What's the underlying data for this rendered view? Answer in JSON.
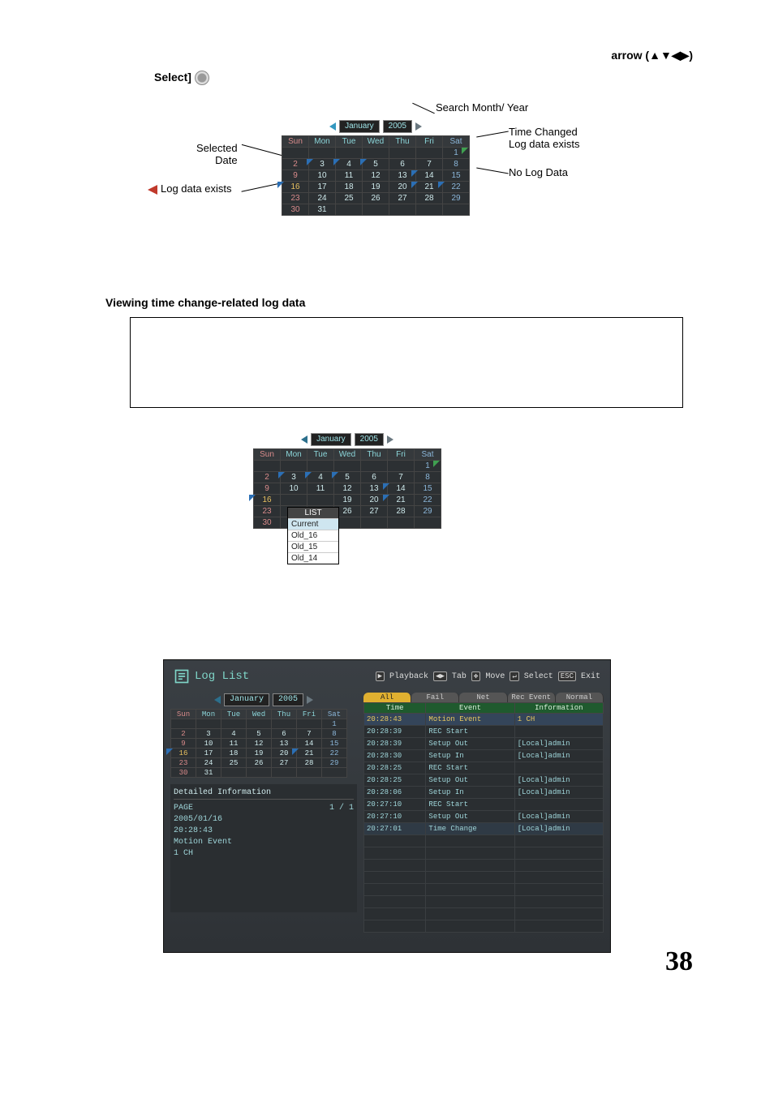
{
  "header": {
    "arrow_label": "arrow (▲▼◀▶)",
    "select_label": "Select]"
  },
  "diagram1": {
    "labels": {
      "search_month_year": "Search Month/ Year",
      "selected_date": "Selected\nDate",
      "log_data_exists": "Log data exists",
      "time_changed": "Time Changed\nLog data exists",
      "no_log_data": "No Log Data"
    }
  },
  "calendar": {
    "month": "January",
    "year": "2005",
    "days": [
      "Sun",
      "Mon",
      "Tue",
      "Wed",
      "Thu",
      "Fri",
      "Sat"
    ],
    "weeks": [
      [
        "",
        "",
        "",
        "",
        "",
        "",
        "1"
      ],
      [
        "2",
        "3",
        "4",
        "5",
        "6",
        "7",
        "8"
      ],
      [
        "9",
        "10",
        "11",
        "12",
        "13",
        "14",
        "15"
      ],
      [
        "16",
        "17",
        "18",
        "19",
        "20",
        "21",
        "22"
      ],
      [
        "23",
        "24",
        "25",
        "26",
        "27",
        "28",
        "29"
      ],
      [
        "30",
        "31",
        "",
        "",
        "",
        "",
        ""
      ]
    ]
  },
  "section2_title": "Viewing time change-related log data",
  "dropdown": {
    "header": "LIST",
    "items": [
      "Current",
      "Old_16",
      "Old_15",
      "Old_14"
    ]
  },
  "loglist": {
    "title": "Log List",
    "hints": [
      "Playback",
      "Tab",
      "Move",
      "Select",
      "Exit"
    ],
    "hint_keys": [
      "▶",
      "◀▶",
      "✥",
      "↵",
      "ESC"
    ],
    "filters": [
      "All",
      "Fail",
      "Net",
      "Rec Event",
      "Normal"
    ],
    "active_filter": 0,
    "table_headers": [
      "Time",
      "Event",
      "Information"
    ],
    "rows": [
      {
        "time": "20:28:43",
        "event": "Motion Event",
        "info": "1 CH",
        "sel": true
      },
      {
        "time": "20:28:39",
        "event": "REC Start",
        "info": ""
      },
      {
        "time": "20:28:39",
        "event": "Setup Out",
        "info": "[Local]admin"
      },
      {
        "time": "20:28:30",
        "event": "Setup In",
        "info": "[Local]admin"
      },
      {
        "time": "20:28:25",
        "event": "REC Start",
        "info": ""
      },
      {
        "time": "20:28:25",
        "event": "Setup Out",
        "info": "[Local]admin"
      },
      {
        "time": "20:28:06",
        "event": "Setup In",
        "info": "[Local]admin"
      },
      {
        "time": "20:27:10",
        "event": "REC Start",
        "info": ""
      },
      {
        "time": "20:27:10",
        "event": "Setup Out",
        "info": "[Local]admin"
      },
      {
        "time": "20:27:01",
        "event": "Time Change",
        "info": "[Local]admin",
        "hl": true
      }
    ],
    "detailed": {
      "header": "Detailed Information",
      "page_label": "PAGE",
      "page_val": "1 / 1",
      "lines": [
        "2005/01/16",
        "20:28:43",
        "Motion Event",
        "1 CH"
      ]
    }
  },
  "page_number": "38"
}
